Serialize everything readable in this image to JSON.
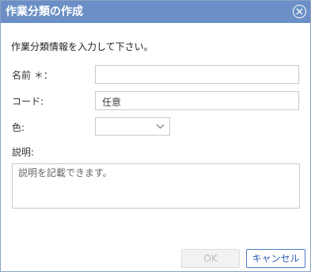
{
  "dialog": {
    "title": "作業分類の作成",
    "instruction": "作業分類情報を入力して下さい。"
  },
  "form": {
    "name_label": "名前 ＊：",
    "name_value": "",
    "code_label": "コード:",
    "code_value": "任意",
    "color_label": "色:",
    "color_value": "",
    "description_label": "説明:",
    "description_placeholder": "説明を記載できます。"
  },
  "buttons": {
    "ok_label": "OK",
    "cancel_label": "キャンセル"
  },
  "colors": {
    "titlebar": "#6b8fc6",
    "accent": "#4a78c8"
  },
  "icons": {
    "close": "close-circle-icon",
    "dropdown": "chevron-down-icon"
  }
}
